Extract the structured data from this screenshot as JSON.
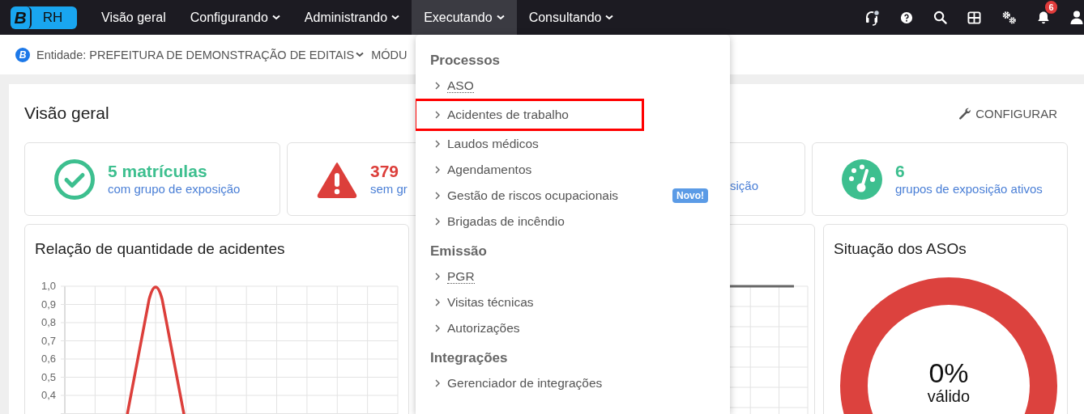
{
  "top_nav": {
    "logo": {
      "mark": "B",
      "label": "RH"
    },
    "items": [
      {
        "label": "Visão geral",
        "dropdown": false,
        "selected": false
      },
      {
        "label": "Configurando",
        "dropdown": true,
        "selected": false
      },
      {
        "label": "Administrando",
        "dropdown": true,
        "selected": false
      },
      {
        "label": "Executando",
        "dropdown": true,
        "selected": true
      },
      {
        "label": "Consultando",
        "dropdown": true,
        "selected": false
      }
    ],
    "notification_count": "6"
  },
  "context_bar": {
    "icon_letter": "B",
    "entity": "Entidade: PREFEITURA DE DEMONSTRAÇÃO DE EDITAIS",
    "module": "MÓDU"
  },
  "page": {
    "title": "Visão geral",
    "configure_button": "CONFIGURAR"
  },
  "stat_cards": [
    {
      "kind": "check",
      "value": "5 matrículas",
      "label": "com grupo de exposição",
      "color": "#3dbf8f"
    },
    {
      "kind": "warning",
      "value": "379",
      "label": "sem gr",
      "color": "#dc3f3b"
    },
    {
      "kind": "covered",
      "label": "sição"
    },
    {
      "kind": "gauge",
      "value": "6",
      "label": "grupos de exposição ativos",
      "color": "#3dbf8f"
    }
  ],
  "charts": [
    {
      "kind": "line",
      "title": "Relação de quantidade de acidentes",
      "y_axis_labels": [
        "1,0",
        "0,9",
        "0,8",
        "0,7",
        "0,6",
        "0,5",
        "0,4"
      ]
    },
    {
      "kind": "covered"
    },
    {
      "kind": "donut",
      "title": "Situação dos ASOs",
      "percent": "0%",
      "caption": "válido"
    }
  ],
  "dropdown_menu": {
    "sections": [
      {
        "heading": "Processos",
        "items": [
          {
            "label": "ASO",
            "underlined": true,
            "highlighted": false
          },
          {
            "label": "Acidentes de trabalho",
            "underlined": false,
            "highlighted": true
          },
          {
            "label": "Laudos médicos",
            "underlined": false,
            "highlighted": false
          },
          {
            "label": "Agendamentos",
            "underlined": false,
            "highlighted": false
          },
          {
            "label": "Gestão de riscos ocupacionais",
            "underlined": false,
            "highlighted": false,
            "badge": "Novo!"
          },
          {
            "label": "Brigadas de incêndio",
            "underlined": false,
            "highlighted": false
          }
        ]
      },
      {
        "heading": "Emissão",
        "items": [
          {
            "label": "PGR",
            "underlined": true,
            "highlighted": false
          },
          {
            "label": "Visitas técnicas",
            "underlined": false,
            "highlighted": false
          },
          {
            "label": "Autorizações",
            "underlined": false,
            "highlighted": false
          }
        ]
      },
      {
        "heading": "Integrações",
        "items": [
          {
            "label": "Gerenciador de integrações",
            "underlined": false,
            "highlighted": false
          }
        ]
      }
    ]
  }
}
